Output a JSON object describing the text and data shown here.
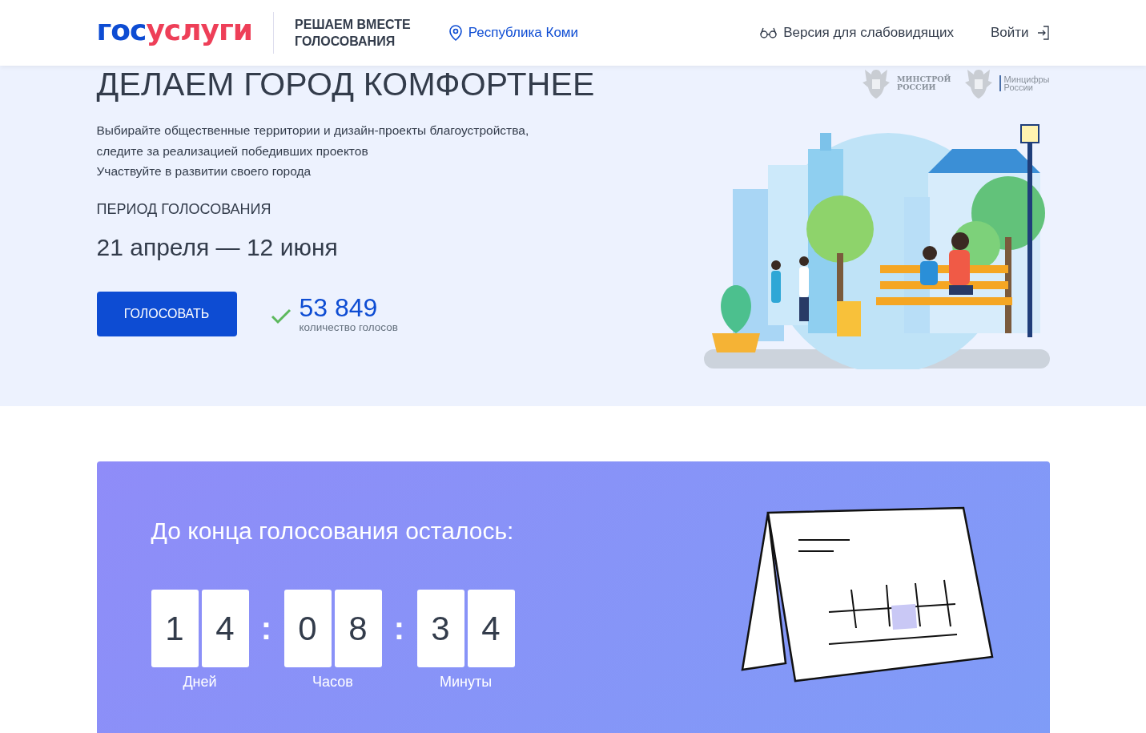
{
  "header": {
    "logo": {
      "part_1": "гос",
      "part_2": "услуги"
    },
    "project_title": "РЕШАЕМ ВМЕСТЕ\nГОЛОСОВАНИЯ",
    "region": "Республика Коми",
    "accessibility_link": "Версия для слабовидящих",
    "login_link": "Войти"
  },
  "hero": {
    "title": "ДЕЛАЕМ ГОРОД КОМФОРТНЕЕ",
    "description": [
      "Выбирайте общественные территории и дизайн-проекты благоустройства,",
      "следите за реализацией победивших проектов",
      "Участвуйте в развитии своего города"
    ],
    "period_label": "ПЕРИОД ГОЛОСОВАНИЯ",
    "period": "21 апреля — 12 июня",
    "vote_button": "ГОЛОСОВАТЬ",
    "votes_count": "53 849",
    "votes_label": "количество голосов",
    "partners": [
      {
        "line_1": "МИНСТРОЙ",
        "line_2": "РОССИИ"
      },
      {
        "line_1": "Минцифры",
        "line_2": "России"
      }
    ]
  },
  "countdown": {
    "title": "До конца голосования осталось:",
    "items": [
      {
        "kind": "unit",
        "digits": [
          "1",
          "4"
        ],
        "label": "Дней"
      },
      {
        "kind": "separator",
        "text": ":"
      },
      {
        "kind": "unit",
        "digits": [
          "0",
          "8"
        ],
        "label": "Часов"
      },
      {
        "kind": "separator",
        "text": ":"
      },
      {
        "kind": "unit",
        "digits": [
          "3",
          "4"
        ],
        "label": "Минуты"
      }
    ]
  }
}
